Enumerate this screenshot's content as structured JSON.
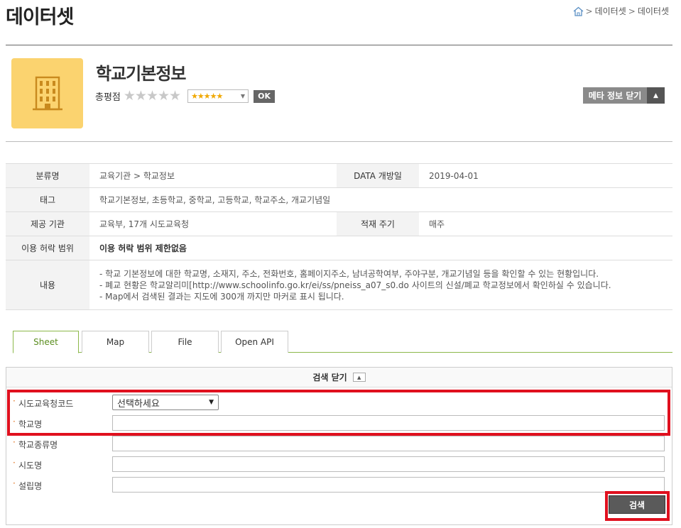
{
  "page": {
    "title": "데이터셋",
    "breadcrumb": [
      "데이터셋",
      "데이터셋"
    ]
  },
  "dataset": {
    "name": "학교기본정보",
    "rating_label": "총평점",
    "rating_select": "★★★★★",
    "ok_label": "OK",
    "meta_toggle_label": "메타 정보 닫기"
  },
  "meta": {
    "category_label": "분류명",
    "category_value": "교육기관 > 학교정보",
    "open_date_label": "DATA 개방일",
    "open_date_value": "2019-04-01",
    "tags_label": "태그",
    "tags_value": "학교기본정보, 초등학교, 중학교, 고등학교, 학교주소, 개교기념일",
    "provider_label": "제공 기관",
    "provider_value": "교육부, 17개 시도교육청",
    "cycle_label": "적재 주기",
    "cycle_value": "매주",
    "license_label": "이용 허락 범위",
    "license_value": "이용 허락 범위 제한없음",
    "content_label": "내용",
    "content_lines": [
      "- 학교 기본정보에 대한 학교명, 소재지, 주소, 전화번호, 홈페이지주소, 남녀공학여부, 주야구분, 개교기념일 등을 확인할 수 있는 현황입니다.",
      "- 폐교 현황은 학교알리미[http://www.schoolinfo.go.kr/ei/ss/pneiss_a07_s0.do 사이트의 신설/폐교 학교정보에서 확인하실 수 있습니다.",
      "- Map에서 검색된 결과는 지도에 300개 까지만 마커로 표시 됩니다."
    ]
  },
  "tabs": [
    {
      "label": "Sheet",
      "active": true
    },
    {
      "label": "Map",
      "active": false
    },
    {
      "label": "File",
      "active": false
    },
    {
      "label": "Open API",
      "active": false
    }
  ],
  "search": {
    "header_label": "검색 닫기",
    "fields": [
      {
        "label": "시도교육청코드",
        "type": "select",
        "value": "선택하세요"
      },
      {
        "label": "학교명",
        "type": "text",
        "value": ""
      },
      {
        "label": "학교종류명",
        "type": "text",
        "value": ""
      },
      {
        "label": "시도명",
        "type": "text",
        "value": ""
      },
      {
        "label": "설립명",
        "type": "text",
        "value": ""
      }
    ],
    "submit_label": "검색"
  },
  "colors": {
    "accent_green": "#8cb84a",
    "highlight_red": "#e0101e",
    "thumbnail_bg": "#fbd36f"
  },
  "icons": [
    "home-icon",
    "building-icon",
    "star-icon",
    "chevron-down-icon",
    "chevron-up-icon"
  ]
}
